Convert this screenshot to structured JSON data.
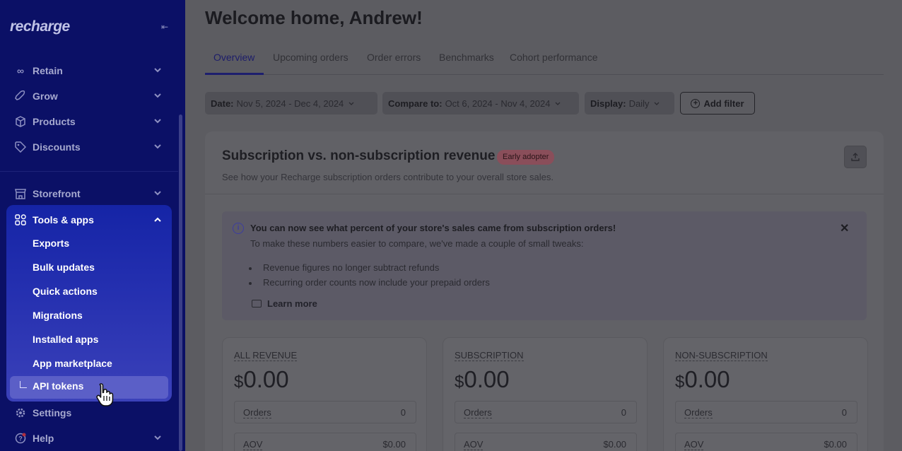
{
  "sidebar": {
    "logo": "recharge",
    "nav": [
      {
        "label": "Retain",
        "icon": "infinity-icon"
      },
      {
        "label": "Grow",
        "icon": "rocket-icon"
      },
      {
        "label": "Products",
        "icon": "box-icon"
      },
      {
        "label": "Discounts",
        "icon": "tag-icon"
      },
      {
        "label": "Storefront",
        "icon": "store-icon"
      }
    ],
    "tools": {
      "label": "Tools & apps",
      "items": [
        "Exports",
        "Bulk updates",
        "Quick actions",
        "Migrations",
        "Installed apps",
        "App marketplace"
      ],
      "active_sub": "API tokens"
    },
    "bottom": [
      {
        "label": "Settings",
        "icon": "gear-icon"
      },
      {
        "label": "Help",
        "icon": "help-icon"
      }
    ]
  },
  "main": {
    "title": "Welcome home, Andrew!",
    "tabs": [
      "Overview",
      "Upcoming orders",
      "Order errors",
      "Benchmarks",
      "Cohort performance"
    ],
    "filters": {
      "date_key": "Date:",
      "date_val": "Nov 5, 2024 - Dec 4, 2024",
      "compare_key": "Compare to:",
      "compare_val": "Oct 6, 2024 - Nov 4, 2024",
      "display_key": "Display:",
      "display_val": "Daily",
      "add": "Add filter"
    },
    "card": {
      "title": "Subscription vs. non-subscription revenue",
      "badge": "Early adopter",
      "subtitle": "See how your Recharge subscription orders contribute to your overall store sales.",
      "notice": {
        "title": "You can now see what percent of your store's sales came from subscription orders!",
        "body": "To make these numbers easier to compare, we've made a couple of small tweaks:",
        "bullets": [
          "Revenue figures no longer subtract refunds",
          "Recurring order counts now include your prepaid orders"
        ],
        "learn_more": "Learn more"
      },
      "metrics": [
        {
          "label": "ALL REVENUE",
          "currency": "$",
          "value": "0.00",
          "orders_label": "Orders",
          "orders": "0",
          "aov_label": "AOV",
          "aov": "$0.00"
        },
        {
          "label": "SUBSCRIPTION",
          "currency": "$",
          "value": "0.00",
          "orders_label": "Orders",
          "orders": "0",
          "aov_label": "AOV",
          "aov": "$0.00"
        },
        {
          "label": "NON-SUBSCRIPTION",
          "currency": "$",
          "value": "0.00",
          "orders_label": "Orders",
          "orders": "0",
          "aov_label": "AOV",
          "aov": "$0.00"
        }
      ]
    }
  },
  "colors": {
    "sidebar_bg": "#0b1066",
    "active_panel": "#2530b0",
    "active_item": "#5b5fc7",
    "overlay_bg": "#5c5c61",
    "badge": "#8a4e5a"
  }
}
